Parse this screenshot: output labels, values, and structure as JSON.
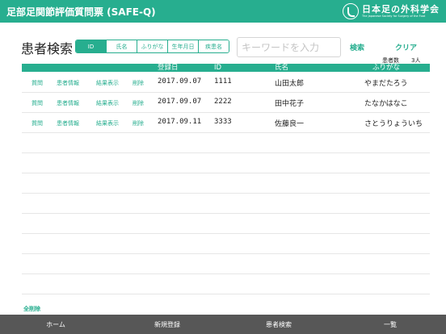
{
  "header": {
    "title": "足部足関節評価質問票 (SAFE-Q)",
    "logo_jp": "日本足の外科学会",
    "logo_en": "The Japanese Society for Surgery of the Foot"
  },
  "page": {
    "title": "患者検索"
  },
  "filter": {
    "segments": [
      "ID",
      "氏名",
      "ふりがな",
      "生年月日",
      "疾患名"
    ],
    "active_index": 0
  },
  "search": {
    "placeholder": "キーワードを入力",
    "search_label": "検索",
    "clear_label": "クリア"
  },
  "count": {
    "label": "患者数",
    "value": "3人"
  },
  "table": {
    "headers": {
      "date": "登録日",
      "id": "ID",
      "name": "氏名",
      "kana": "ふりがな"
    },
    "actions": [
      "質問",
      "患者情報",
      "結果表示",
      "削除"
    ],
    "rows": [
      {
        "date": "2017.09.07",
        "id": "1111",
        "name": "山田太郎",
        "kana": "やまだたろう"
      },
      {
        "date": "2017.09.07",
        "id": "2222",
        "name": "田中花子",
        "kana": "たなかはなこ"
      },
      {
        "date": "2017.09.11",
        "id": "3333",
        "name": "佐藤良一",
        "kana": "さとうりょういち"
      }
    ]
  },
  "footer": {
    "delete_all_label": "全削除"
  },
  "tabbar": {
    "items": [
      "ホーム",
      "新規登録",
      "患者検索",
      "一覧"
    ]
  },
  "colors": {
    "accent": "#27ae8f",
    "tabbar": "#575757"
  }
}
